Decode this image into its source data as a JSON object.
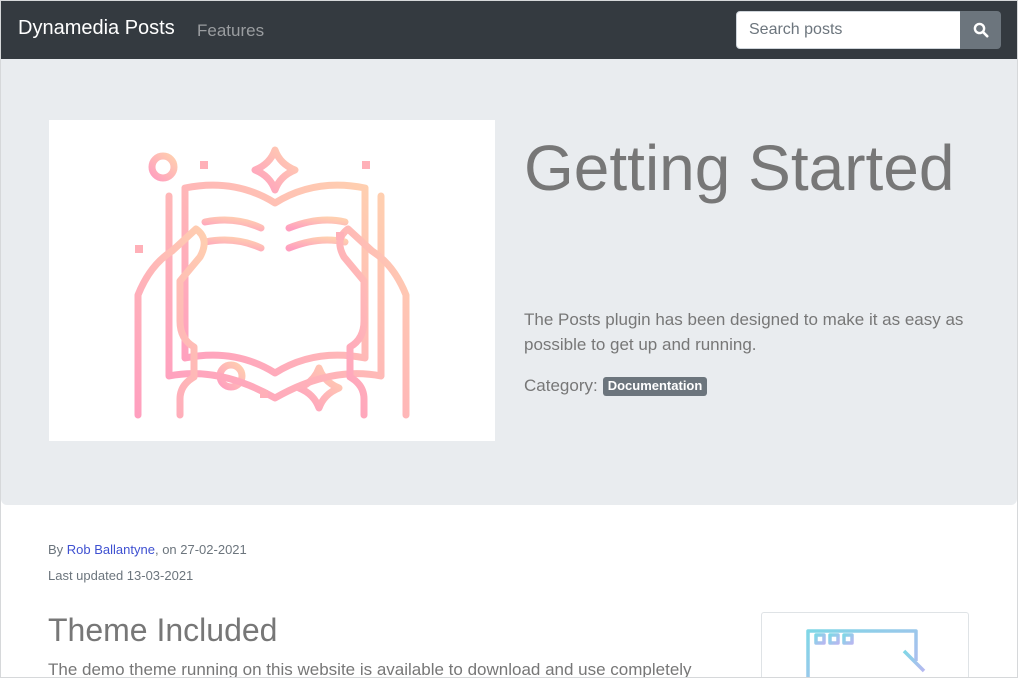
{
  "navbar": {
    "brand": "Dynamedia Posts",
    "links": [
      {
        "label": "Features"
      }
    ],
    "search": {
      "placeholder": "Search posts",
      "value": "",
      "icon": "search-icon"
    }
  },
  "hero": {
    "image_icon": "open-book-illustration",
    "title": "Getting Started",
    "lead": "The Posts plugin has been designed to make it as easy as possible to get up and running.",
    "category_label": "Category:",
    "category_badge": "Documentation"
  },
  "post_meta": {
    "by_prefix": "By",
    "author": "Rob Ballantyne",
    "date_text": ", on 27-02-2021",
    "updated": "Last updated 13-03-2021"
  },
  "content": {
    "section_title": "Theme Included",
    "section_text": "The demo theme running on this website is available to download and use completely",
    "card_icon": "browser-window-illustration"
  },
  "colors": {
    "navbar_bg": "#343a40",
    "jumbotron_bg": "#e9ecef",
    "badge_bg": "#6c757d",
    "link": "#3f51d1",
    "illustration_gradient_start": "#ff9fbf",
    "illustration_gradient_end": "#ffcfb0",
    "card_gradient_start": "#7fd7e6",
    "card_gradient_end": "#b7b8f0"
  }
}
